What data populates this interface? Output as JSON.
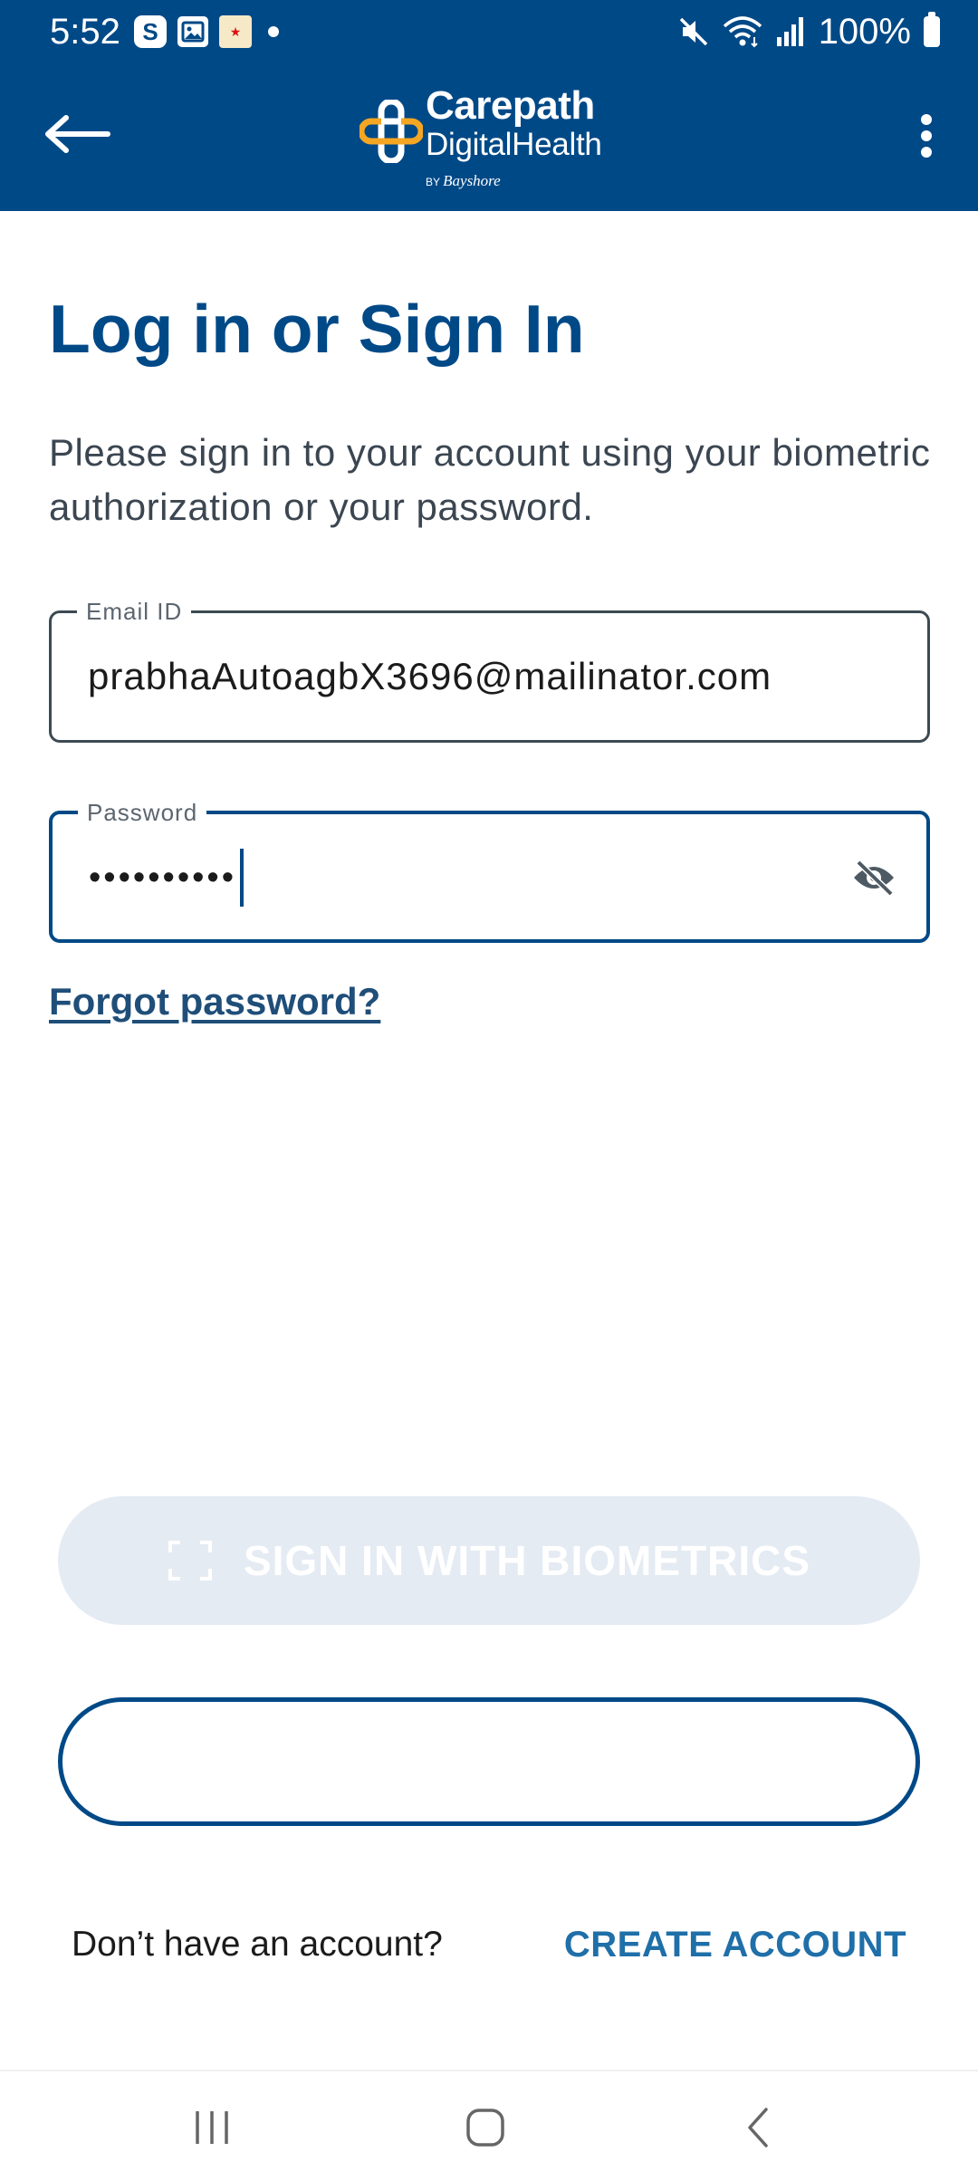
{
  "status_bar": {
    "time": "5:52",
    "notification_icons": [
      "s-app-icon",
      "gallery-icon",
      "game-app-icon"
    ],
    "system_icons": [
      "mute-icon",
      "wifi-icon",
      "signal-icon",
      "battery-icon"
    ],
    "battery": "100%"
  },
  "header": {
    "brand_line1": "Carepath",
    "brand_line2": "DigitalHealth",
    "brand_by": "BY",
    "brand_parent": "Bayshore",
    "colors": {
      "background": "#004987",
      "accent": "#F5A623"
    }
  },
  "content": {
    "title": "Log in or Sign In",
    "subtitle": "Please sign in to your account using your biometric authorization or your password.",
    "email": {
      "label": "Email ID",
      "value": "prabhaAutoagbX3696@mailinator.com"
    },
    "password": {
      "label": "Password",
      "masked_value": "••••••••••"
    },
    "forgot_password": "Forgot password?",
    "biometrics_button": "SIGN IN WITH BIOMETRICS",
    "login_button": "",
    "no_account_text": "Don’t have an account?",
    "create_account": "CREATE ACCOUNT"
  },
  "nav": {
    "buttons": [
      "recents-icon",
      "home-icon",
      "back-icon"
    ]
  }
}
